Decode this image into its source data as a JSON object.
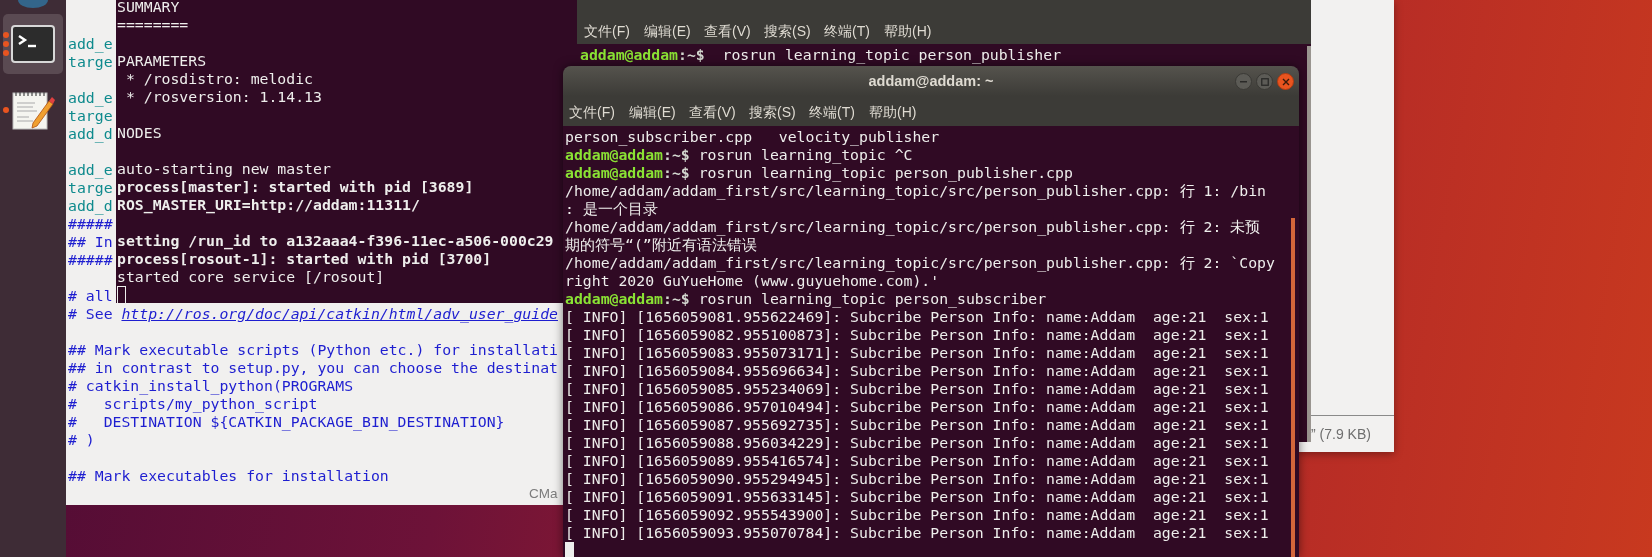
{
  "dock": {
    "items": [
      {
        "kind": "app",
        "selected": false
      },
      {
        "kind": "terminal",
        "selected": true,
        "running": true
      },
      {
        "kind": "editor",
        "selected": false,
        "running": true
      }
    ]
  },
  "editor": {
    "lines": [
      {
        "kind": "blank"
      },
      {
        "kind": "blank"
      },
      {
        "kind": "function",
        "text": "add_e"
      },
      {
        "kind": "function",
        "text": "targe"
      },
      {
        "kind": "blank"
      },
      {
        "kind": "function",
        "text": "add_e"
      },
      {
        "kind": "function",
        "text": "targe"
      },
      {
        "kind": "function",
        "text": "add_d"
      },
      {
        "kind": "blank"
      },
      {
        "kind": "function",
        "text": "add_e"
      },
      {
        "kind": "function",
        "text": "targe"
      },
      {
        "kind": "function",
        "text": "add_d"
      },
      {
        "kind": "comment",
        "text": "#####"
      },
      {
        "kind": "comment",
        "text": "## In"
      },
      {
        "kind": "comment",
        "text": "#####"
      },
      {
        "kind": "blank"
      },
      {
        "kind": "comment",
        "text": "# all"
      },
      {
        "kind": "link",
        "text": "# See ",
        "link": "http://ros.org/doc/api/catkin/html/adv_user_guide"
      },
      {
        "kind": "blank"
      },
      {
        "kind": "comment",
        "text": "## Mark executable scripts (Python etc.) for installati"
      },
      {
        "kind": "comment",
        "text": "## in contrast to setup.py, you can choose the destinat"
      },
      {
        "kind": "comment",
        "text": "# catkin_install_python(PROGRAMS"
      },
      {
        "kind": "comment",
        "text": "#   scripts/my_python_script"
      },
      {
        "kind": "comment",
        "text": "#   DESTINATION ${CATKIN_PACKAGE_BIN_DESTINATION}"
      },
      {
        "kind": "comment",
        "text": "# )"
      },
      {
        "kind": "blank"
      },
      {
        "kind": "comment",
        "text": "## Mark executables for installation"
      }
    ],
    "status": "CMa"
  },
  "file_window": {
    "status": "” (7.9 KB)"
  },
  "terminal_roscore": {
    "lines": [
      {
        "kind": "text",
        "bold": false,
        "text": "SUMMARY"
      },
      {
        "kind": "text",
        "bold": false,
        "text": "========"
      },
      {
        "kind": "blank"
      },
      {
        "kind": "text",
        "bold": false,
        "text": "PARAMETERS"
      },
      {
        "kind": "text",
        "bold": false,
        "text": " * /rosdistro: melodic"
      },
      {
        "kind": "text",
        "bold": false,
        "text": " * /rosversion: 1.14.13"
      },
      {
        "kind": "blank"
      },
      {
        "kind": "text",
        "bold": false,
        "text": "NODES"
      },
      {
        "kind": "blank"
      },
      {
        "kind": "text",
        "bold": false,
        "text": "auto-starting new master"
      },
      {
        "kind": "text",
        "bold": true,
        "text": "process[master]: started with pid [3689]"
      },
      {
        "kind": "text",
        "bold": true,
        "text": "ROS_MASTER_URI=http://addam:11311/"
      },
      {
        "kind": "blank"
      },
      {
        "kind": "text",
        "bold": true,
        "text": "setting /run_id to a132aaa4-f396-11ec-a506-000c29"
      },
      {
        "kind": "text",
        "bold": true,
        "text": "process[rosout-1]: started with pid [3700]"
      },
      {
        "kind": "text",
        "bold": false,
        "text": "started core service [/rosout]"
      },
      {
        "kind": "cursor",
        "focused": false
      }
    ]
  },
  "terminal_back": {
    "menu": [
      "文件(F)",
      "编辑(E)",
      "查看(V)",
      "搜索(S)",
      "终端(T)",
      "帮助(H)"
    ],
    "lines": [
      {
        "kind": "prompt",
        "user": "addam@addam",
        "path": ":~$",
        "command": "  rosrun learning_topic person_publisher"
      }
    ]
  },
  "terminal_front": {
    "title": "addam@addam: ~",
    "menu": [
      "文件(F)",
      "编辑(E)",
      "查看(V)",
      "搜索(S)",
      "终端(T)",
      "帮助(H)"
    ],
    "lines": [
      {
        "kind": "text",
        "bold": false,
        "text": "person_subscriber.cpp   velocity_publisher"
      },
      {
        "kind": "prompt",
        "user": "addam@addam",
        "path": ":~$",
        "command": " rosrun learning_topic ^C"
      },
      {
        "kind": "prompt",
        "user": "addam@addam",
        "path": ":~$",
        "command": " rosrun learning_topic person_publisher.cpp"
      },
      {
        "kind": "text",
        "bold": false,
        "text": "/home/addam/addam_first/src/learning_topic/src/person_publisher.cpp: 行 1: /bin"
      },
      {
        "kind": "text",
        "bold": false,
        "text": ": 是一个目录"
      },
      {
        "kind": "text",
        "bold": false,
        "text": "/home/addam/addam_first/src/learning_topic/src/person_publisher.cpp: 行 2: 未预"
      },
      {
        "kind": "text",
        "bold": false,
        "text": "期的符号“(”附近有语法错误"
      },
      {
        "kind": "text",
        "bold": false,
        "text": "/home/addam/addam_first/src/learning_topic/src/person_publisher.cpp: 行 2: `Copy"
      },
      {
        "kind": "text",
        "bold": false,
        "text": "right 2020 GuYueHome (www.guyuehome.com).'"
      },
      {
        "kind": "prompt",
        "user": "addam@addam",
        "path": ":~$",
        "command": " rosrun learning_topic person_subscriber"
      },
      {
        "kind": "text",
        "bold": false,
        "text": "[ INFO] [1656059081.955622469]: Subcribe Person Info: name:Addam  age:21  sex:1"
      },
      {
        "kind": "text",
        "bold": false,
        "text": "[ INFO] [1656059082.955100873]: Subcribe Person Info: name:Addam  age:21  sex:1"
      },
      {
        "kind": "text",
        "bold": false,
        "text": "[ INFO] [1656059083.955073171]: Subcribe Person Info: name:Addam  age:21  sex:1"
      },
      {
        "kind": "text",
        "bold": false,
        "text": "[ INFO] [1656059084.955696634]: Subcribe Person Info: name:Addam  age:21  sex:1"
      },
      {
        "kind": "text",
        "bold": false,
        "text": "[ INFO] [1656059085.955234069]: Subcribe Person Info: name:Addam  age:21  sex:1"
      },
      {
        "kind": "text",
        "bold": false,
        "text": "[ INFO] [1656059086.957010494]: Subcribe Person Info: name:Addam  age:21  sex:1"
      },
      {
        "kind": "text",
        "bold": false,
        "text": "[ INFO] [1656059087.955692735]: Subcribe Person Info: name:Addam  age:21  sex:1"
      },
      {
        "kind": "text",
        "bold": false,
        "text": "[ INFO] [1656059088.956034229]: Subcribe Person Info: name:Addam  age:21  sex:1"
      },
      {
        "kind": "text",
        "bold": false,
        "text": "[ INFO] [1656059089.955416574]: Subcribe Person Info: name:Addam  age:21  sex:1"
      },
      {
        "kind": "text",
        "bold": false,
        "text": "[ INFO] [1656059090.955294945]: Subcribe Person Info: name:Addam  age:21  sex:1"
      },
      {
        "kind": "text",
        "bold": false,
        "text": "[ INFO] [1656059091.955633145]: Subcribe Person Info: name:Addam  age:21  sex:1"
      },
      {
        "kind": "text",
        "bold": false,
        "text": "[ INFO] [1656059092.955543900]: Subcribe Person Info: name:Addam  age:21  sex:1"
      },
      {
        "kind": "text",
        "bold": false,
        "text": "[ INFO] [1656059093.955070784]: Subcribe Person Info: name:Addam  age:21  sex:1"
      },
      {
        "kind": "cursor",
        "focused": true
      }
    ]
  }
}
